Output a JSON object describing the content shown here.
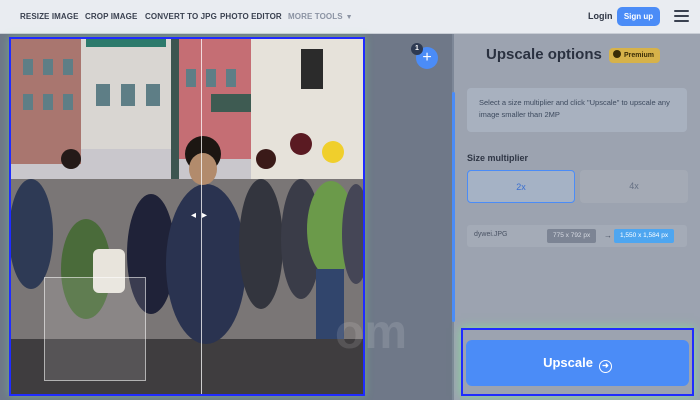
{
  "nav": {
    "items": [
      "RESIZE IMAGE",
      "CROP IMAGE",
      "CONVERT TO JPG",
      "PHOTO EDITOR"
    ],
    "more": "MORE TOOLS",
    "login": "Login",
    "signup": "Sign up"
  },
  "workspace": {
    "add_badge": "1",
    "add_symbol": "+",
    "watermark": "om"
  },
  "panel": {
    "title": "Upscale options",
    "premium": "Premium",
    "info": "Select a size multiplier and click \"Upscale\" to upscale any image smaller than 2MP",
    "size_label": "Size multiplier",
    "multipliers": [
      "2x",
      "4x"
    ],
    "selected_multiplier": "2x",
    "file": {
      "name": "dywei.JPG",
      "original": "775 x 792 px",
      "upscaled": "1,550 x 1,584 px"
    },
    "upscale_button": "Upscale"
  },
  "colors": {
    "accent": "#4b8cf7",
    "premium": "#d6b24a",
    "highlight": "#1f2cff"
  }
}
